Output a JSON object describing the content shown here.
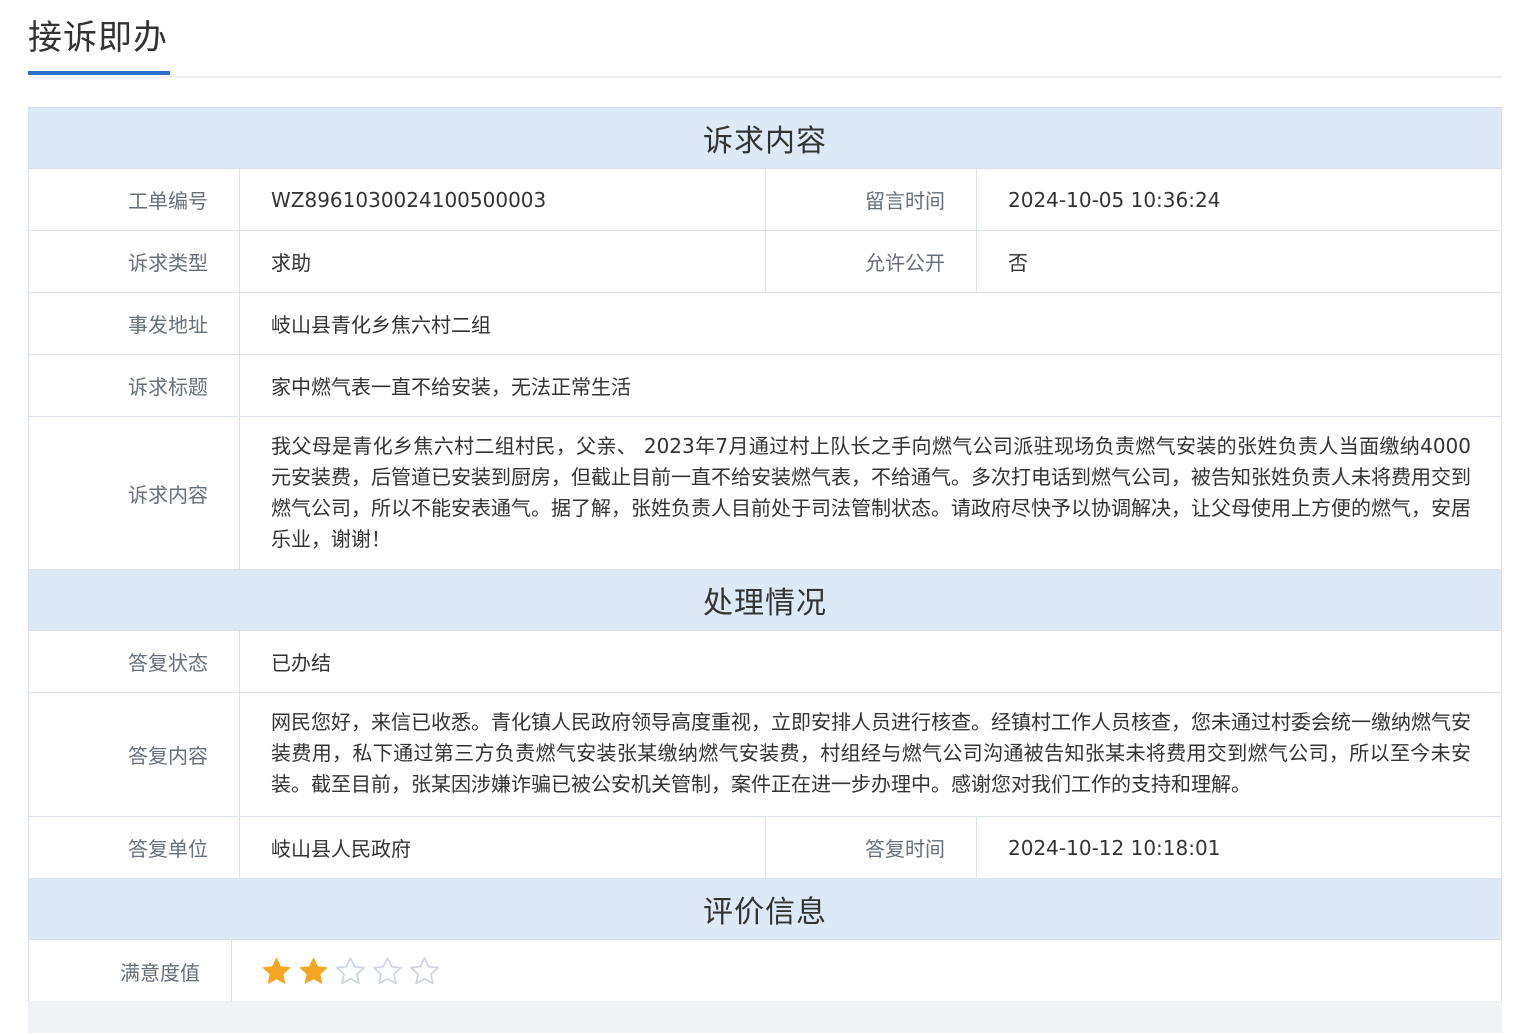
{
  "page": {
    "title": "接诉即办"
  },
  "sections": {
    "complaint": {
      "heading": "诉求内容",
      "order_no_label": "工单编号",
      "order_no": "WZ8961030024100500003",
      "message_time_label": "留言时间",
      "message_time": "2024-10-05 10:36:24",
      "type_label": "诉求类型",
      "type": "求助",
      "public_label": "允许公开",
      "public": "否",
      "address_label": "事发地址",
      "address": "岐山县青化乡焦六村二组",
      "subject_label": "诉求标题",
      "subject": "家中燃气表一直不给安装，无法正常生活",
      "content_label": "诉求内容",
      "content": "我父母是青化乡焦六村二组村民，父亲、       2023年7月通过村上队长之手向燃气公司派驻现场负责燃气安装的张姓负责人当面缴纳4000元安装费，后管道已安装到厨房，但截止目前一直不给安装燃气表，不给通气。多次打电话到燃气公司，被告知张姓负责人未将费用交到燃气公司，所以不能安表通气。据了解，张姓负责人目前处于司法管制状态。请政府尽快予以协调解决，让父母使用上方便的燃气，安居乐业，谢谢！"
    },
    "handling": {
      "heading": "处理情况",
      "status_label": "答复状态",
      "status": "已办结",
      "reply_label": "答复内容",
      "reply": "网民您好，来信已收悉。青化镇人民政府领导高度重视，立即安排人员进行核查。经镇村工作人员核查，您未通过村委会统一缴纳燃气安装费用，私下通过第三方负责燃气安装张某缴纳燃气安装费，村组经与燃气公司沟通被告知张某未将费用交到燃气公司，所以至今未安装。截至目前，张某因涉嫌诈骗已被公安机关管制，案件正在进一步办理中。感谢您对我们工作的支持和理解。",
      "unit_label": "答复单位",
      "unit": "岐山县人民政府",
      "reply_time_label": "答复时间",
      "reply_time": "2024-10-12 10:18:01"
    },
    "evaluation": {
      "heading": "评价信息",
      "satisfaction_label": "满意度值",
      "rating": 2,
      "max_rating": 5,
      "star_icon": "star-icon",
      "star_filled_color": "#f5a623",
      "star_empty_color": "#cfd6df"
    }
  },
  "colors": {
    "accent": "#2e70c8",
    "section_bg": "#dde9f7",
    "border": "#dde3ea"
  }
}
